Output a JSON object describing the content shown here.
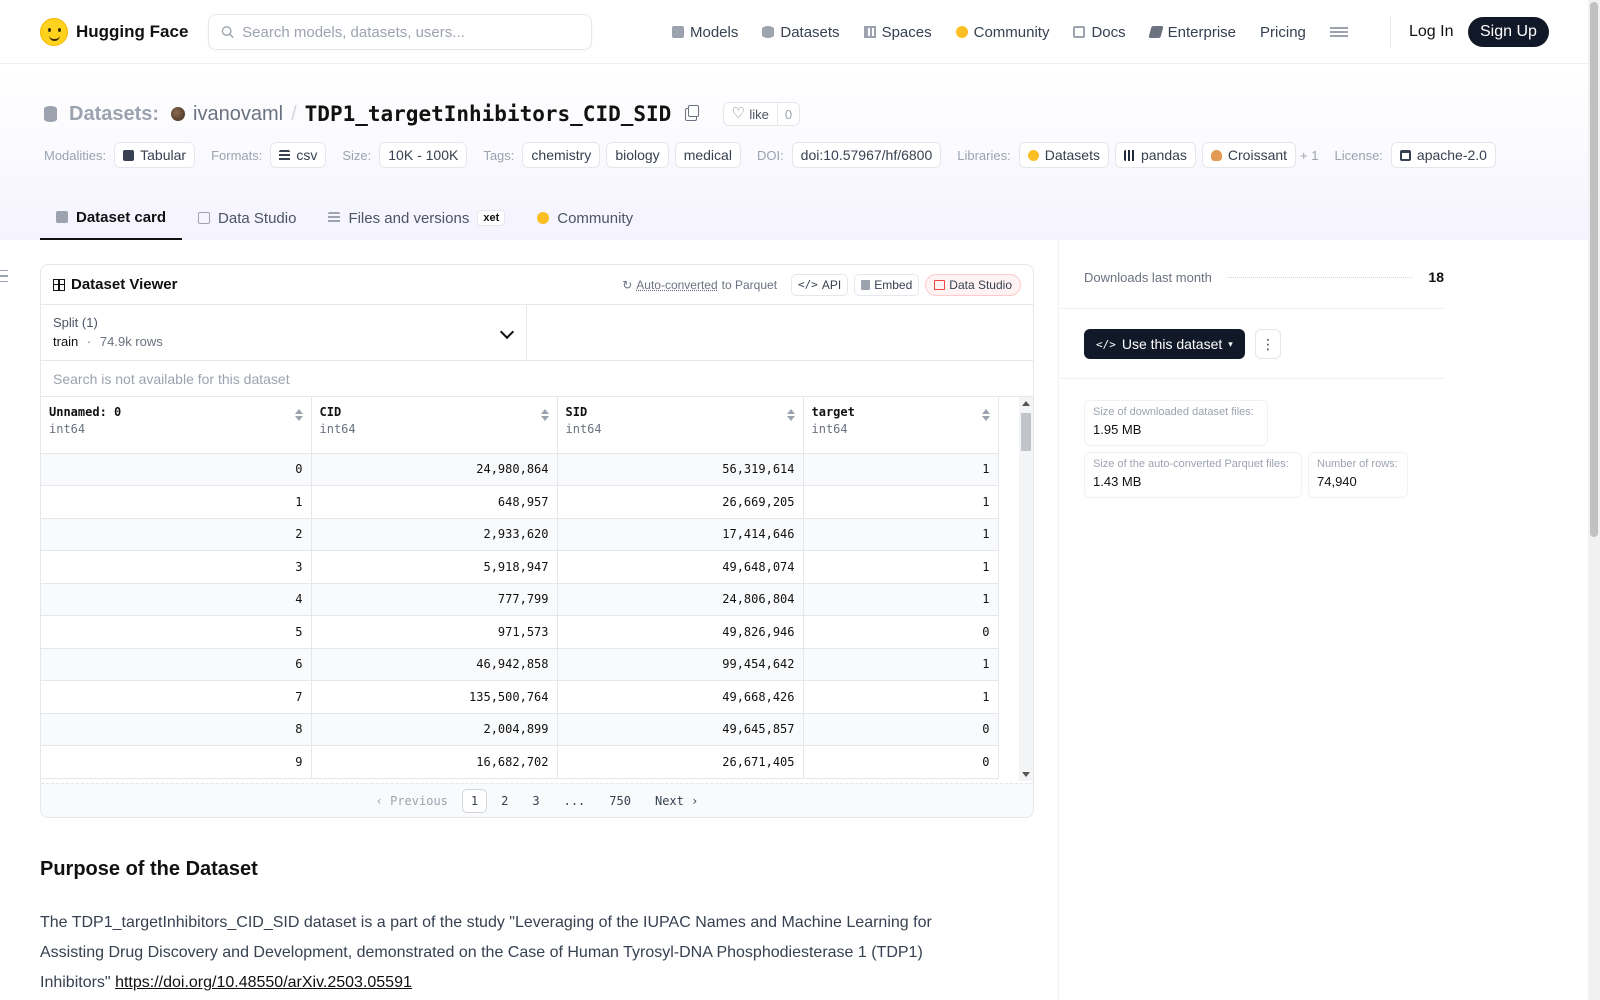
{
  "brand": "Hugging Face",
  "search_placeholder": "Search models, datasets, users...",
  "nav": [
    {
      "label": "Models"
    },
    {
      "label": "Datasets"
    },
    {
      "label": "Spaces"
    },
    {
      "label": "Community"
    },
    {
      "label": "Docs"
    },
    {
      "label": "Enterprise"
    },
    {
      "label": "Pricing"
    }
  ],
  "login": "Log In",
  "signup": "Sign Up",
  "title": {
    "section": "Datasets:",
    "owner": "ivanovaml",
    "slash": "/",
    "repo": "TDP1_targetInhibitors_CID_SID",
    "like_label": "like",
    "like_count": "0"
  },
  "meta": {
    "modalities_label": "Modalities:",
    "modalities": "Tabular",
    "formats_label": "Formats:",
    "formats": "csv",
    "size_label": "Size:",
    "size": "10K - 100K",
    "tags_label": "Tags:",
    "tags": [
      "chemistry",
      "biology",
      "medical"
    ],
    "doi_label": "DOI:",
    "doi": "doi:10.57967/hf/6800",
    "libraries_label": "Libraries:",
    "libraries": [
      "Datasets",
      "pandas",
      "Croissant"
    ],
    "libraries_more": "+ 1",
    "license_label": "License:",
    "license": "apache-2.0"
  },
  "tabs": [
    {
      "label": "Dataset card"
    },
    {
      "label": "Data Studio"
    },
    {
      "label": "Files and versions"
    },
    {
      "label": "Community"
    }
  ],
  "xet_badge": "xet",
  "viewer": {
    "title": "Dataset Viewer",
    "auto_converted": "Auto-converted",
    "to_parquet": "to Parquet",
    "api": "API",
    "embed": "Embed",
    "data_studio": "Data Studio",
    "split_label": "Split (1)",
    "split_value": "train",
    "split_sep": "·",
    "split_rows": "74.9k rows",
    "search_placeholder": "Search is not available for this dataset",
    "columns": [
      {
        "name": "Unnamed: 0",
        "type": "int64"
      },
      {
        "name": "CID",
        "type": "int64"
      },
      {
        "name": "SID",
        "type": "int64"
      },
      {
        "name": "target",
        "type": "int64"
      }
    ],
    "rows": [
      [
        "0",
        "24,980,864",
        "56,319,614",
        "1"
      ],
      [
        "1",
        "648,957",
        "26,669,205",
        "1"
      ],
      [
        "2",
        "2,933,620",
        "17,414,646",
        "1"
      ],
      [
        "3",
        "5,918,947",
        "49,648,074",
        "1"
      ],
      [
        "4",
        "777,799",
        "24,806,804",
        "1"
      ],
      [
        "5",
        "971,573",
        "49,826,946",
        "0"
      ],
      [
        "6",
        "46,942,858",
        "99,454,642",
        "1"
      ],
      [
        "7",
        "135,500,764",
        "49,668,426",
        "1"
      ],
      [
        "8",
        "2,004,899",
        "49,645,857",
        "0"
      ],
      [
        "9",
        "16,682,702",
        "26,671,405",
        "0"
      ]
    ],
    "pager": {
      "previous": "Previous",
      "pages": [
        "1",
        "2",
        "3",
        "...",
        "750"
      ],
      "next": "Next"
    }
  },
  "sidebar": {
    "downloads_label": "Downloads last month",
    "downloads": "18",
    "use_dataset": "Use this dataset",
    "more": "⋮",
    "stats": [
      {
        "label": "Size of downloaded dataset files:",
        "value": "1.95 MB"
      },
      {
        "label": "Size of the auto-converted Parquet files:",
        "value": "1.43 MB"
      },
      {
        "label": "Number of rows:",
        "value": "74,940"
      }
    ]
  },
  "content": {
    "heading": "Purpose of the Dataset",
    "paragraph": "The TDP1_targetInhibitors_CID_SID dataset is a part of the study \"Leveraging of the IUPAC Names and Machine Learning for Assisting Drug Discovery and Development, demonstrated on the Case of Human Tyrosyl-DNA Phosphodiesterase 1 (TDP1) Inhibitors\"",
    "link": "https://doi.org/10.48550/arXiv.2503.05591"
  }
}
